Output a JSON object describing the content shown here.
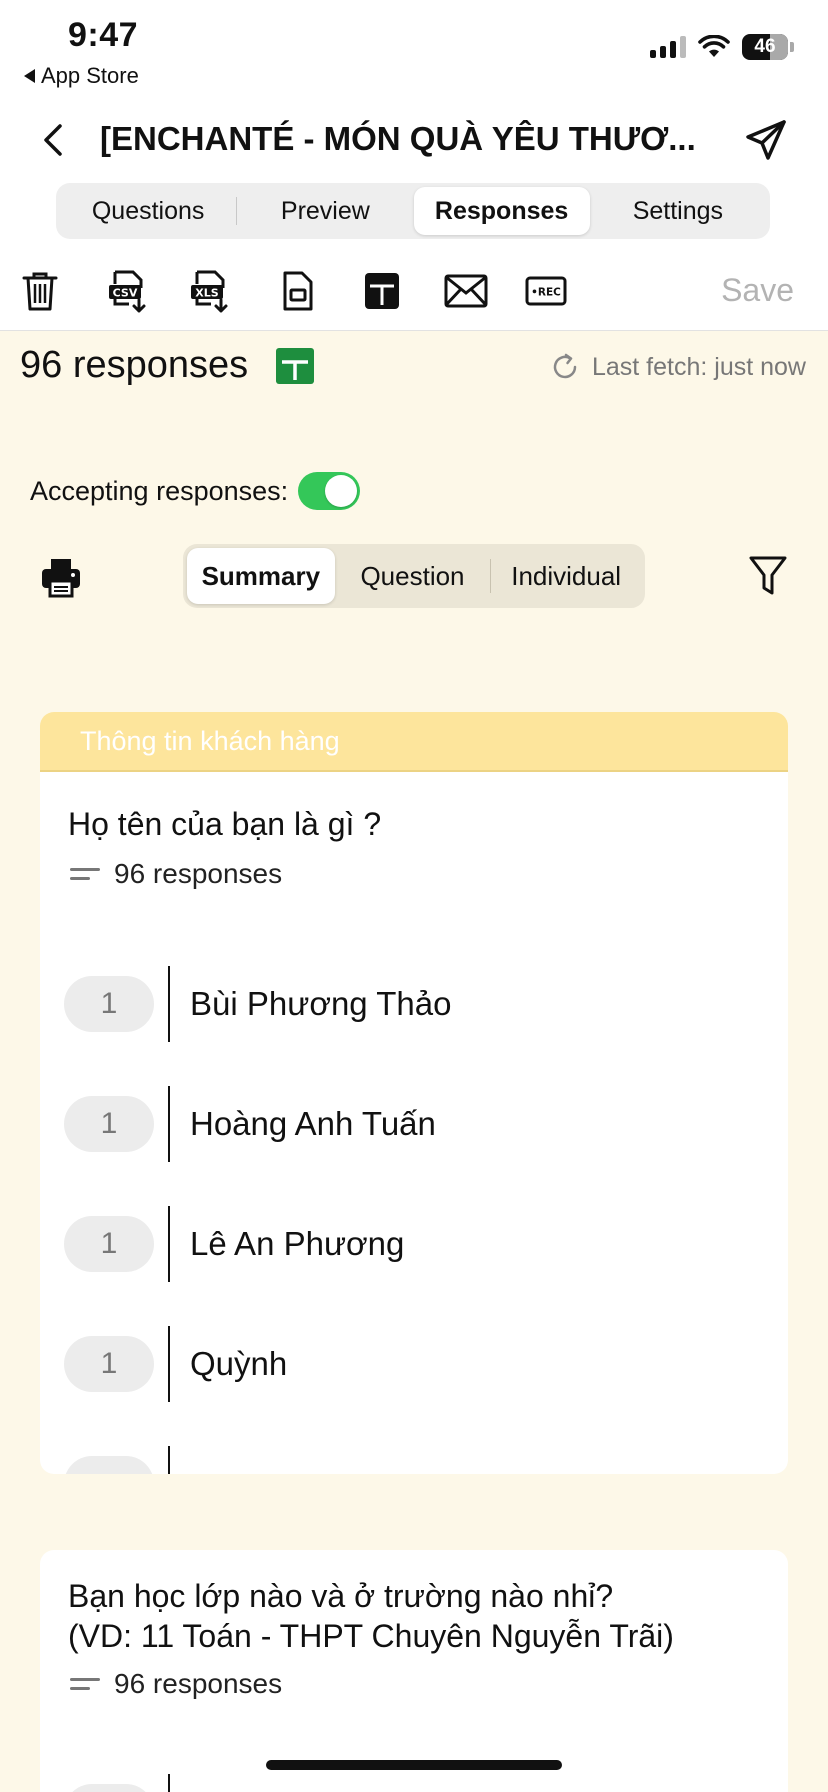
{
  "status_bar": {
    "time": "9:47",
    "back_app": "App Store",
    "battery": "46"
  },
  "header": {
    "title": "[ENCHANTÉ - MÓN QUÀ YÊU THƯƠ...",
    "tabs": [
      {
        "label": "Questions",
        "active": false
      },
      {
        "label": "Preview",
        "active": false
      },
      {
        "label": "Responses",
        "active": true
      },
      {
        "label": "Settings",
        "active": false
      }
    ]
  },
  "toolbar": {
    "icons": [
      "trash-icon",
      "csv-download-icon",
      "xls-download-icon",
      "document-icon",
      "sheets-icon",
      "mail-icon",
      "rec-icon"
    ],
    "csv_label": "CSV",
    "xls_label": "XLS",
    "rec_label": "•REC",
    "save_label": "Save"
  },
  "summary": {
    "response_count": "96 responses",
    "last_fetch": "Last fetch: just now",
    "accepting_label": "Accepting responses:",
    "accepting": true,
    "view_tabs": [
      {
        "label": "Summary",
        "active": true
      },
      {
        "label": "Question",
        "active": false
      },
      {
        "label": "Individual",
        "active": false
      }
    ]
  },
  "sections": [
    {
      "header": "Thông tin khách hàng",
      "question": "Họ tên của bạn là gì ?",
      "count": "96 responses",
      "answers": [
        {
          "count": "1",
          "text": "Bùi Phương Thảo"
        },
        {
          "count": "1",
          "text": "Hoàng Anh Tuấn"
        },
        {
          "count": "1",
          "text": "Lê An Phương"
        },
        {
          "count": "1",
          "text": "Quỳnh"
        }
      ]
    },
    {
      "question_line1": "Bạn học lớp nào và ở trường nào nhỉ?",
      "question_line2": "(VD: 11 Toán - THPT Chuyên Nguyễn Trãi)",
      "count": "96 responses"
    }
  ],
  "colors": {
    "background": "#fdf8e8",
    "section_header": "#fde59c",
    "toggle_on": "#34c759",
    "sheets_green": "#1e8e3e"
  }
}
